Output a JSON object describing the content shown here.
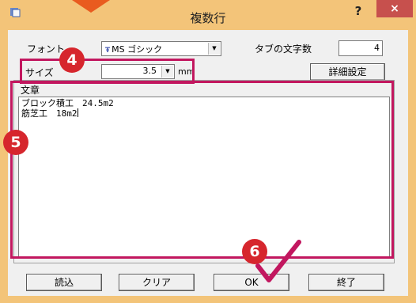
{
  "window": {
    "title": "複数行",
    "help_glyph": "?",
    "close_glyph": "×"
  },
  "font_row": {
    "label": "フォント",
    "font_value": "MS ゴシック",
    "tt_glyph": "Ŧ",
    "tab_label": "タブの文字数",
    "tab_value": "4"
  },
  "size_row": {
    "label": "サイズ",
    "size_value": "3.5",
    "unit": "mm",
    "detail_button": "詳細設定"
  },
  "text_group": {
    "title": "文章",
    "lines": [
      "ブロック積工　24.5m2",
      "筋芝工　18m2"
    ]
  },
  "buttons": {
    "load": "読込",
    "clear": "クリア",
    "ok": "OK",
    "exit": "終了"
  },
  "annotations": {
    "badge_4": "4",
    "badge_5": "5",
    "badge_6": "6",
    "highlight_color": "#c2175f",
    "badge_color": "#d6262d"
  },
  "colors": {
    "title_bar": "#f3c479",
    "close_button": "#c7504d"
  }
}
